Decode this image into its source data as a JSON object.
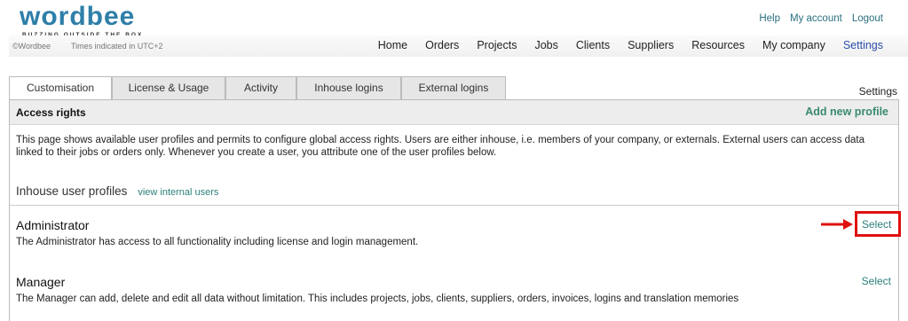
{
  "brand": {
    "logo_word": "wordbee",
    "tagline": "BUZZING OUTSIDE THE BOX",
    "copyright": "©Wordbee",
    "timezone_note": "Times indicated in UTC+2"
  },
  "top_links": [
    "Help",
    "My account",
    "Logout"
  ],
  "main_nav": [
    {
      "label": "Home",
      "active": false
    },
    {
      "label": "Orders",
      "active": false
    },
    {
      "label": "Projects",
      "active": false
    },
    {
      "label": "Jobs",
      "active": false
    },
    {
      "label": "Clients",
      "active": false
    },
    {
      "label": "Suppliers",
      "active": false
    },
    {
      "label": "Resources",
      "active": false
    },
    {
      "label": "My company",
      "active": false
    },
    {
      "label": "Settings",
      "active": true
    }
  ],
  "tabs": [
    "Customisation",
    "License & Usage",
    "Activity",
    "Inhouse logins",
    "External logins"
  ],
  "active_tab": "Customisation",
  "page_label": "Settings",
  "panel": {
    "title": "Access rights",
    "add_profile_label": "Add new profile",
    "description": "This page shows available user profiles and permits to configure global access rights. Users are either inhouse, i.e. members of your company, or externals. External users can access data linked to their jobs or orders only. Whenever you create a user, you attribute one of the user profiles below.",
    "section_title": "Inhouse user profiles",
    "section_link": "view internal users"
  },
  "profiles": [
    {
      "name": "Administrator",
      "description": "The Administrator has access to all functionality including license and login management.",
      "select_label": "Select",
      "highlighted": true
    },
    {
      "name": "Manager",
      "description": "The Manager can add, delete and edit all data without limitation. This includes projects, jobs, clients, suppliers, orders, invoices, logins and translation memories",
      "select_label": "Select",
      "highlighted": false
    }
  ],
  "colors": {
    "link_teal": "#2a7f7a",
    "brand_blue": "#2e7fa8",
    "active_nav": "#2b4da8",
    "highlight_red": "#e01010"
  }
}
